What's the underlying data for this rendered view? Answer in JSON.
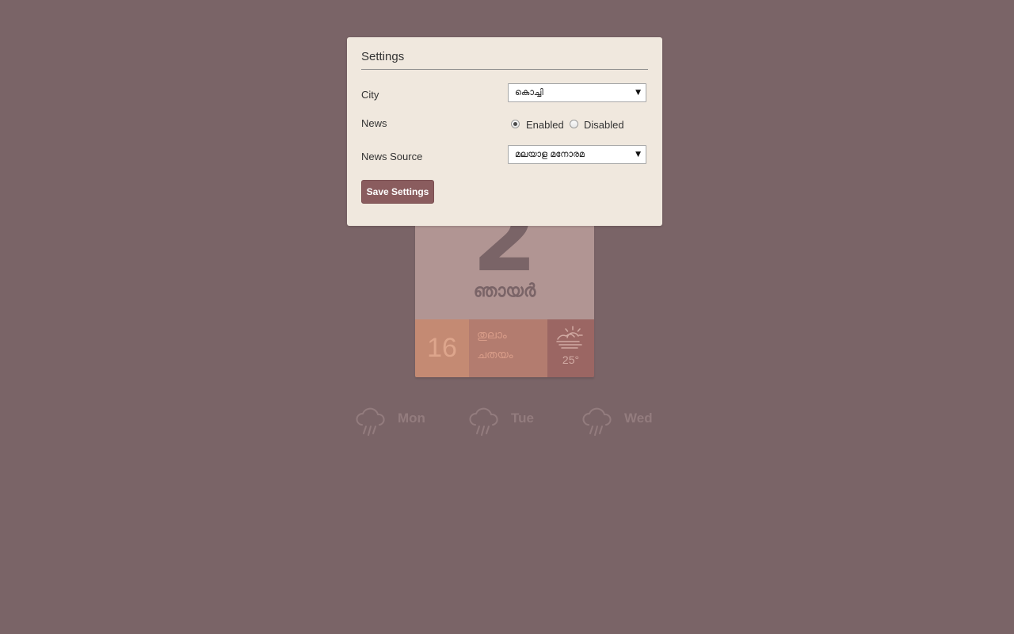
{
  "calendar": {
    "date": "2",
    "day_name": "ഞായർ",
    "malayalam_date": "16",
    "malayalam_month": "തുലാം",
    "star": "ചതയം",
    "weather_icon": "sun-behind-haze-icon",
    "temperature": "25°"
  },
  "forecast": [
    {
      "day": "Mon",
      "icon": "rain-icon"
    },
    {
      "day": "Tue",
      "icon": "rain-icon"
    },
    {
      "day": "Wed",
      "icon": "rain-icon"
    }
  ],
  "settings": {
    "title": "Settings",
    "city_label": "City",
    "city_value": "കൊച്ചി",
    "news_label": "News",
    "news_enabled_label": "Enabled",
    "news_disabled_label": "Disabled",
    "news_selected": "Enabled",
    "news_source_label": "News Source",
    "news_source_value": "മലയാള മനോരമ",
    "save_label": "Save Settings"
  },
  "colors": {
    "background": "#7a6467",
    "modal_background": "#f0e8de",
    "button": "#8a5c5e",
    "card_top": "#b19593",
    "malayalam_date_tile": "#c48a73",
    "malayalam_info_tile": "#b37c6f",
    "weather_tile": "#9b6663"
  }
}
